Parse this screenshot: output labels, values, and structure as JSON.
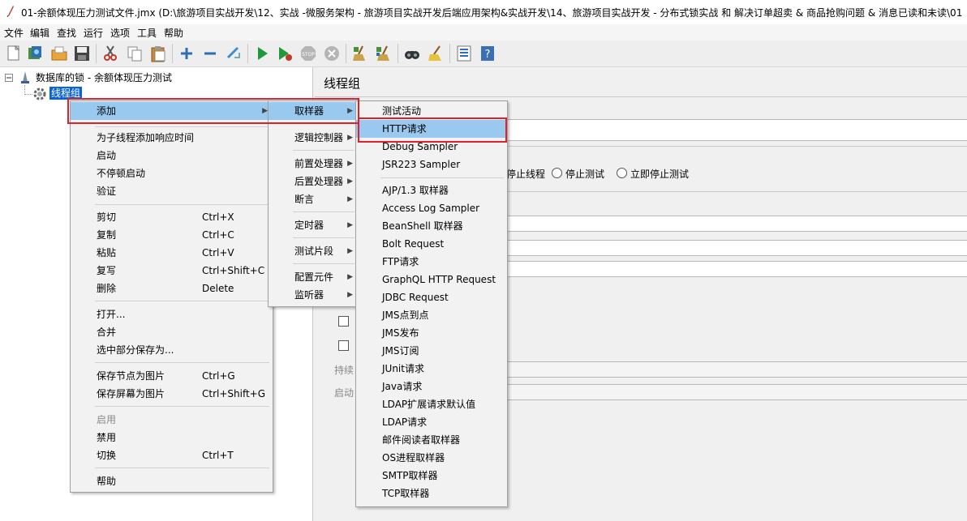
{
  "window": {
    "title": "01-余额体现压力测试文件.jmx (D:\\旅游项目实战开发\\12、实战 -微服务架构 - 旅游项目实战开发后端应用架构&实战开发\\14、旅游项目实战开发 - 分布式锁实战 和 解决订单超卖 & 商品抢购问题 & 消息已读和未读\\01"
  },
  "menubar": [
    "文件",
    "编辑",
    "查找",
    "运行",
    "选项",
    "工具",
    "帮助"
  ],
  "toolbar": {
    "icons": [
      "new-icon",
      "templates-icon",
      "open-icon",
      "save-icon",
      "cut-icon",
      "copy-icon",
      "paste-icon",
      "expand-icon",
      "collapse-icon",
      "toggle-icon",
      "start-icon",
      "start-no-pause-icon",
      "stop-icon",
      "shutdown-icon",
      "clear-icon",
      "clear-all-icon",
      "search-icon",
      "reset-search-icon",
      "function-helper-icon",
      "help-icon"
    ]
  },
  "tree": {
    "root_label": "数据库的锁 - 余额体现压力测试",
    "child_label": "线程组"
  },
  "right_panel": {
    "title": "线程组",
    "action_options": [
      "停止线程",
      "停止测试",
      "立即停止测试"
    ],
    "partial_labels": [
      "持续",
      "启动"
    ]
  },
  "context_menu": {
    "items": [
      {
        "label": "添加",
        "has_submenu": true
      },
      {
        "label": "为子线程添加响应时间"
      },
      {
        "label": "启动"
      },
      {
        "label": "不停顿启动"
      },
      {
        "label": "验证"
      },
      {
        "label": "剪切",
        "shortcut": "Ctrl+X"
      },
      {
        "label": "复制",
        "shortcut": "Ctrl+C"
      },
      {
        "label": "粘贴",
        "shortcut": "Ctrl+V"
      },
      {
        "label": "复写",
        "shortcut": "Ctrl+Shift+C"
      },
      {
        "label": "删除",
        "shortcut": "Delete"
      },
      {
        "label": "打开..."
      },
      {
        "label": "合并"
      },
      {
        "label": "选中部分保存为..."
      },
      {
        "label": "保存节点为图片",
        "shortcut": "Ctrl+G"
      },
      {
        "label": "保存屏幕为图片",
        "shortcut": "Ctrl+Shift+G"
      },
      {
        "label": "启用",
        "disabled": true
      },
      {
        "label": "禁用"
      },
      {
        "label": "切换",
        "shortcut": "Ctrl+T"
      },
      {
        "label": "帮助"
      }
    ]
  },
  "add_submenu": {
    "items": [
      {
        "label": "取样器"
      },
      {
        "label": "逻辑控制器"
      },
      {
        "label": "前置处理器"
      },
      {
        "label": "后置处理器"
      },
      {
        "label": "断言"
      },
      {
        "label": "定时器"
      },
      {
        "label": "测试片段"
      },
      {
        "label": "配置元件"
      },
      {
        "label": "监听器"
      }
    ]
  },
  "sampler_submenu": {
    "items": [
      "测试活动",
      "HTTP请求",
      "Debug Sampler",
      "JSR223 Sampler",
      "AJP/1.3 取样器",
      "Access Log Sampler",
      "BeanShell 取样器",
      "Bolt Request",
      "FTP请求",
      "GraphQL HTTP Request",
      "JDBC Request",
      "JMS点到点",
      "JMS发布",
      "JMS订阅",
      "JUnit请求",
      "Java请求",
      "LDAP扩展请求默认值",
      "LDAP请求",
      "邮件阅读者取样器",
      "OS进程取样器",
      "SMTP取样器",
      "TCP取样器"
    ]
  },
  "colors": {
    "highlight": "#99c9ef",
    "selection": "#0a64d8",
    "annotation_box": "#e0202a"
  }
}
